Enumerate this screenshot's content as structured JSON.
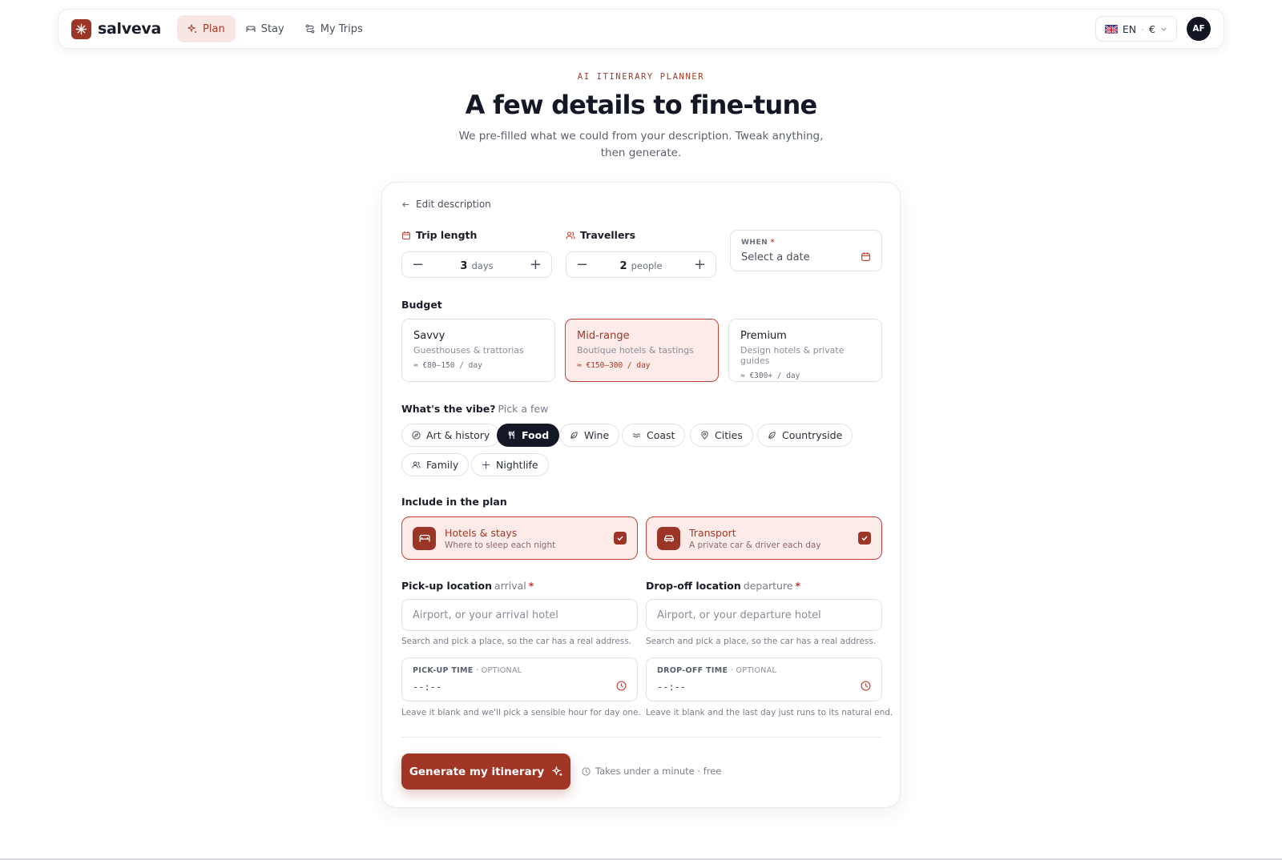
{
  "nav": {
    "brand": "salveva",
    "items": [
      {
        "label": "Plan",
        "icon": "sparkle-icon",
        "active": true
      },
      {
        "label": "Stay",
        "icon": "bed-icon",
        "active": false
      },
      {
        "label": "My Trips",
        "icon": "route-icon",
        "active": false
      }
    ],
    "language": "EN",
    "currency": "€",
    "avatar_initials": "AF"
  },
  "hero": {
    "eyebrow": "AI ITINERARY PLANNER",
    "title": "A few details to fine-tune",
    "subtitle": "We pre-filled what we could from your description. Tweak anything, then generate."
  },
  "form": {
    "edit_description": "Edit description",
    "trip_length": {
      "label": "Trip length",
      "value": "3",
      "unit": "days"
    },
    "travellers": {
      "label": "Travellers",
      "value": "2",
      "unit": "people"
    },
    "when": {
      "label": "WHEN",
      "required_mark": "*",
      "placeholder": "Select a date"
    },
    "budget": {
      "label": "Budget",
      "options": [
        {
          "name": "Savvy",
          "desc": "Guesthouses & trattorias",
          "price": "≈ €80–150 / day",
          "selected": false
        },
        {
          "name": "Mid-range",
          "desc": "Boutique hotels & tastings",
          "price": "≈ €150–300 / day",
          "selected": true
        },
        {
          "name": "Premium",
          "desc": "Design hotels & private guides",
          "price": "≈ €300+ / day",
          "selected": false
        }
      ]
    },
    "vibe": {
      "label": "What's the vibe?",
      "hint": "Pick a few",
      "chips": [
        {
          "label": "Art & history",
          "icon": "compass-icon",
          "selected": false
        },
        {
          "label": "Food",
          "icon": "utensils-icon",
          "selected": true
        },
        {
          "label": "Wine",
          "icon": "leaf-icon",
          "selected": false
        },
        {
          "label": "Coast",
          "icon": "waves-icon",
          "selected": false
        },
        {
          "label": "Cities",
          "icon": "map-pin-icon",
          "selected": false
        },
        {
          "label": "Countryside",
          "icon": "leaf-icon",
          "selected": false
        },
        {
          "label": "Family",
          "icon": "users-icon",
          "selected": false
        },
        {
          "label": "Nightlife",
          "icon": "sparkle-icon",
          "selected": false
        }
      ]
    },
    "include": {
      "label": "Include in the plan",
      "options": [
        {
          "title": "Hotels & stays",
          "desc": "Where to sleep each night",
          "icon": "bed-icon",
          "checked": true
        },
        {
          "title": "Transport",
          "desc": "A private car & driver each day",
          "icon": "car-icon",
          "checked": true
        }
      ]
    },
    "pickup": {
      "label": "Pick-up location",
      "qualifier": "arrival",
      "required_mark": "*",
      "placeholder": "Airport, or your arrival hotel",
      "hint": "Search and pick a place, so the car has a real address."
    },
    "dropoff": {
      "label": "Drop-off location",
      "qualifier": "departure",
      "required_mark": "*",
      "placeholder": "Airport, or your departure hotel",
      "hint": "Search and pick a place, so the car has a real address."
    },
    "pickup_time": {
      "label": "PICK-UP TIME",
      "optional": "· OPTIONAL",
      "value": "--:--",
      "hint": "Leave it blank and we'll pick a sensible hour for day one."
    },
    "dropoff_time": {
      "label": "DROP-OFF TIME",
      "optional": "· OPTIONAL",
      "value": "--:--",
      "hint": "Leave it blank and the last day just runs to its natural end."
    },
    "generate_label": "Generate my itinerary",
    "generate_note": "Takes under a minute · free"
  },
  "colors": {
    "accent": "#a13626",
    "accent_soft": "#fcebe8",
    "dark": "#141826"
  }
}
